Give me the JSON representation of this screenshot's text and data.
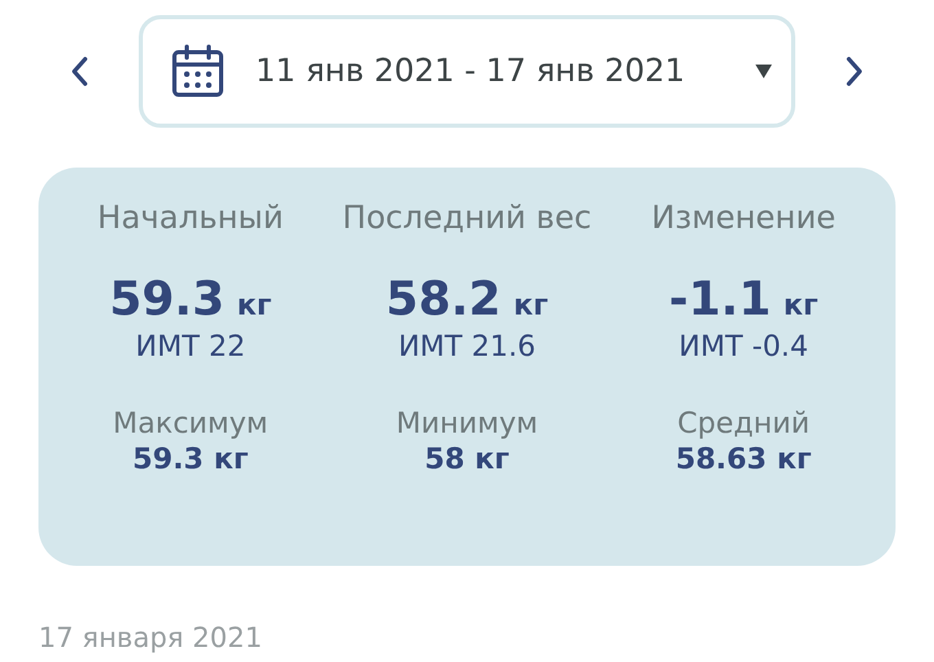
{
  "date_range": {
    "label": "11 янв 2021 - 17 янв 2021"
  },
  "stats": [
    {
      "label": "Начальный",
      "value": "59.3",
      "unit": "кг",
      "bmi": "ИМТ 22"
    },
    {
      "label": "Последний вес",
      "value": "58.2",
      "unit": "кг",
      "bmi": "ИМТ 21.6"
    },
    {
      "label": "Изменение",
      "value": "-1.1",
      "unit": "кг",
      "bmi": "ИМТ -0.4"
    }
  ],
  "summary": [
    {
      "label": "Максимум",
      "value": "59.3 кг"
    },
    {
      "label": "Минимум",
      "value": "58 кг"
    },
    {
      "label": "Средний",
      "value": "58.63 кг"
    }
  ],
  "day_heading": "17 января 2021"
}
